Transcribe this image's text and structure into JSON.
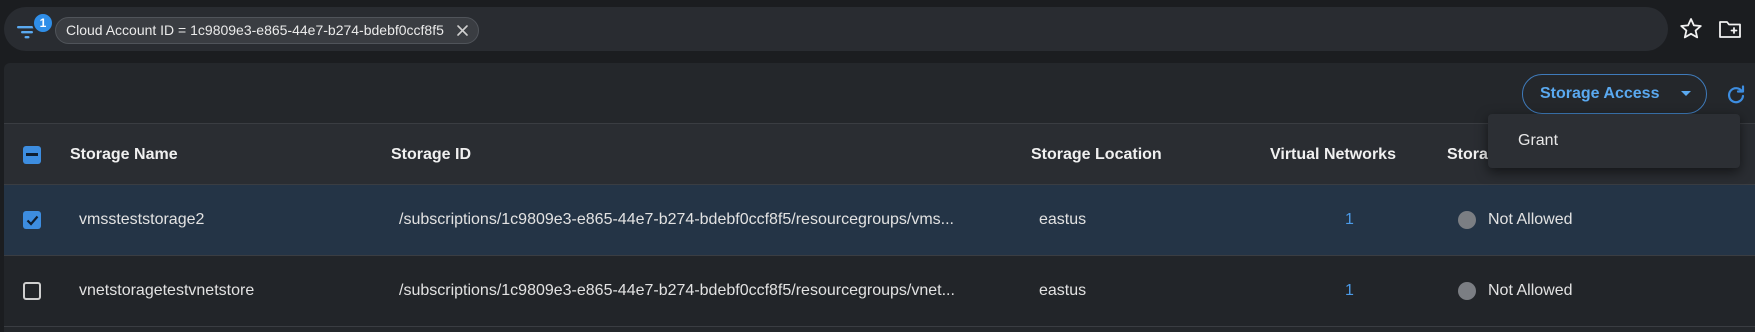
{
  "filter": {
    "badge_count": "1",
    "chip_label": "Cloud Account ID = 1c9809e3-e865-44e7-b274-bdebf0ccf8f5"
  },
  "toolbar": {
    "storage_access_label": "Storage Access"
  },
  "dropdown": {
    "items": [
      "Grant"
    ]
  },
  "table": {
    "columns": [
      "Storage Name",
      "Storage ID",
      "Storage Location",
      "Virtual Networks",
      "Stora"
    ],
    "rows": [
      {
        "selected": true,
        "name": "vmssteststorage2",
        "id": "/subscriptions/1c9809e3-e865-44e7-b274-bdebf0ccf8f5/resourcegroups/vms...",
        "location": "eastus",
        "virtual_networks": "1",
        "status": "Not Allowed"
      },
      {
        "selected": false,
        "name": "vnetstoragetestvnetstore",
        "id": "/subscriptions/1c9809e3-e865-44e7-b274-bdebf0ccf8f5/resourcegroups/vnet...",
        "location": "eastus",
        "virtual_networks": "1",
        "status": "Not Allowed"
      }
    ]
  },
  "colors": {
    "accent": "#2f8ee8",
    "link": "#4c9be8",
    "selected_row": "#243446",
    "status_dot": "#7b7e83"
  },
  "icons": [
    "filter-icon",
    "close-icon",
    "star-icon",
    "folder-add-icon",
    "chevron-down-icon",
    "refresh-icon",
    "indeterminate-checkbox-icon",
    "checkbox-checked-icon",
    "checkbox-empty-icon"
  ]
}
